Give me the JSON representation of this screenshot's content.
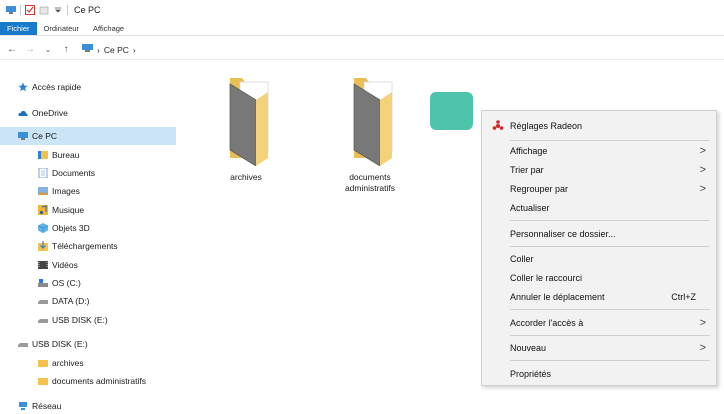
{
  "window": {
    "title": "Ce PC"
  },
  "ribbon": {
    "tabs": [
      "Fichier",
      "Ordinateur",
      "Affichage"
    ]
  },
  "address": {
    "crumbs": [
      "Ce PC",
      ">"
    ]
  },
  "sidebar": {
    "items": [
      {
        "label": "Accès rapide",
        "icon": "star-icon"
      },
      {
        "label": "OneDrive",
        "icon": "cloud-icon"
      },
      {
        "label": "Ce PC",
        "icon": "computer-icon"
      },
      {
        "label": "Bureau",
        "icon": "desktop-icon"
      },
      {
        "label": "Documents",
        "icon": "documents-icon"
      },
      {
        "label": "Images",
        "icon": "images-icon"
      },
      {
        "label": "Musique",
        "icon": "music-icon"
      },
      {
        "label": "Objets 3D",
        "icon": "objects3d-icon"
      },
      {
        "label": "Téléchargements",
        "icon": "downloads-icon"
      },
      {
        "label": "Vidéos",
        "icon": "videos-icon"
      },
      {
        "label": "OS (C:)",
        "icon": "drive-icon"
      },
      {
        "label": "DATA (D:)",
        "icon": "drive-icon"
      },
      {
        "label": "USB DISK (E:)",
        "icon": "usb-drive-icon"
      },
      {
        "label": "USB DISK (E:)",
        "icon": "usb-drive-icon"
      },
      {
        "label": "archives",
        "icon": "folder-icon"
      },
      {
        "label": "documents administratifs",
        "icon": "folder-icon"
      },
      {
        "label": "Réseau",
        "icon": "network-icon"
      }
    ]
  },
  "content": {
    "folders": [
      {
        "label_line1": "archives",
        "label_line2": ""
      },
      {
        "label_line1": "documents",
        "label_line2": "administratifs"
      }
    ]
  },
  "context_menu": {
    "items": [
      {
        "label": "Réglages Radeon",
        "icon": "radeon-icon"
      },
      {
        "label": "Affichage",
        "arrow": ">"
      },
      {
        "label": "Trier par",
        "arrow": ">"
      },
      {
        "label": "Regrouper par",
        "arrow": ">"
      },
      {
        "label": "Actualiser"
      },
      {
        "label": "Personnaliser ce dossier..."
      },
      {
        "label": "Coller"
      },
      {
        "label": "Coller le raccourci"
      },
      {
        "label": "Annuler le déplacement",
        "shortcut": "Ctrl+Z"
      },
      {
        "label": "Accorder l'accès à",
        "arrow": ">"
      },
      {
        "label": "Nouveau",
        "arrow": ">"
      },
      {
        "label": "Propriétés"
      }
    ]
  },
  "colors": {
    "accent": "#1979ca",
    "selection": "#cce4f7",
    "teal": "#4fc4ad",
    "folder": "#f3d27a"
  }
}
